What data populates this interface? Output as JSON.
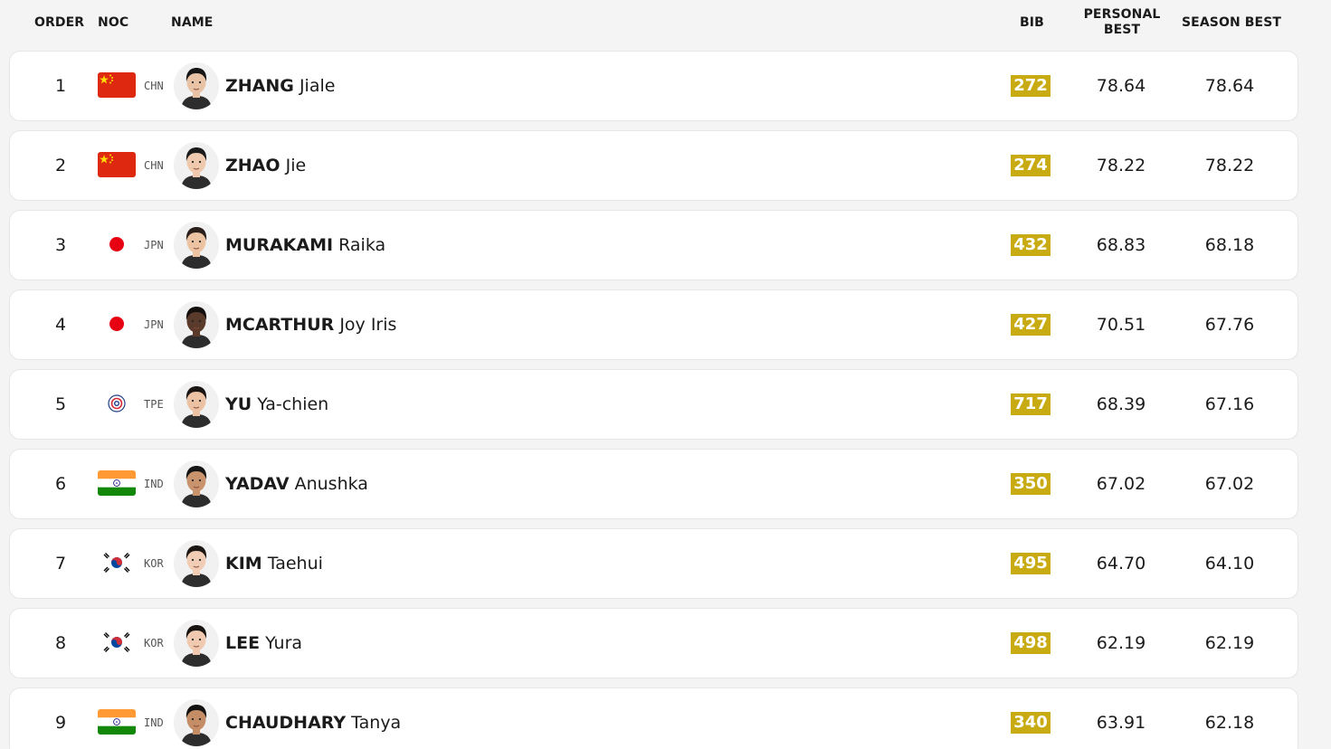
{
  "header": {
    "order": "ORDER",
    "noc": "NOC",
    "name": "NAME",
    "bib": "BIB",
    "personal_best": "PERSONAL BEST",
    "season_best": "SEASON BEST"
  },
  "colors": {
    "bib_badge": "#c8ab12",
    "row_bg": "#ffffff",
    "page_bg": "#f4f4f4"
  },
  "athletes": [
    {
      "order": "1",
      "noc": "CHN",
      "flag": "china-flag-icon",
      "last": "ZHANG",
      "first": "Jiale",
      "bib": "272",
      "pb": "78.64",
      "sb": "78.64"
    },
    {
      "order": "2",
      "noc": "CHN",
      "flag": "china-flag-icon",
      "last": "ZHAO",
      "first": "Jie",
      "bib": "274",
      "pb": "78.22",
      "sb": "78.22"
    },
    {
      "order": "3",
      "noc": "JPN",
      "flag": "japan-flag-icon",
      "last": "MURAKAMI",
      "first": "Raika",
      "bib": "432",
      "pb": "68.83",
      "sb": "68.18"
    },
    {
      "order": "4",
      "noc": "JPN",
      "flag": "japan-flag-icon",
      "last": "MCARTHUR",
      "first": "Joy Iris",
      "bib": "427",
      "pb": "70.51",
      "sb": "67.76"
    },
    {
      "order": "5",
      "noc": "TPE",
      "flag": "chinese-taipei-flag-icon",
      "last": "YU",
      "first": "Ya-chien",
      "bib": "717",
      "pb": "68.39",
      "sb": "67.16"
    },
    {
      "order": "6",
      "noc": "IND",
      "flag": "india-flag-icon",
      "last": "YADAV",
      "first": "Anushka",
      "bib": "350",
      "pb": "67.02",
      "sb": "67.02"
    },
    {
      "order": "7",
      "noc": "KOR",
      "flag": "korea-flag-icon",
      "last": "KIM",
      "first": "Taehui",
      "bib": "495",
      "pb": "64.70",
      "sb": "64.10"
    },
    {
      "order": "8",
      "noc": "KOR",
      "flag": "korea-flag-icon",
      "last": "LEE",
      "first": "Yura",
      "bib": "498",
      "pb": "62.19",
      "sb": "62.19"
    },
    {
      "order": "9",
      "noc": "IND",
      "flag": "india-flag-icon",
      "last": "CHAUDHARY",
      "first": "Tanya",
      "bib": "340",
      "pb": "63.91",
      "sb": "62.18"
    }
  ]
}
